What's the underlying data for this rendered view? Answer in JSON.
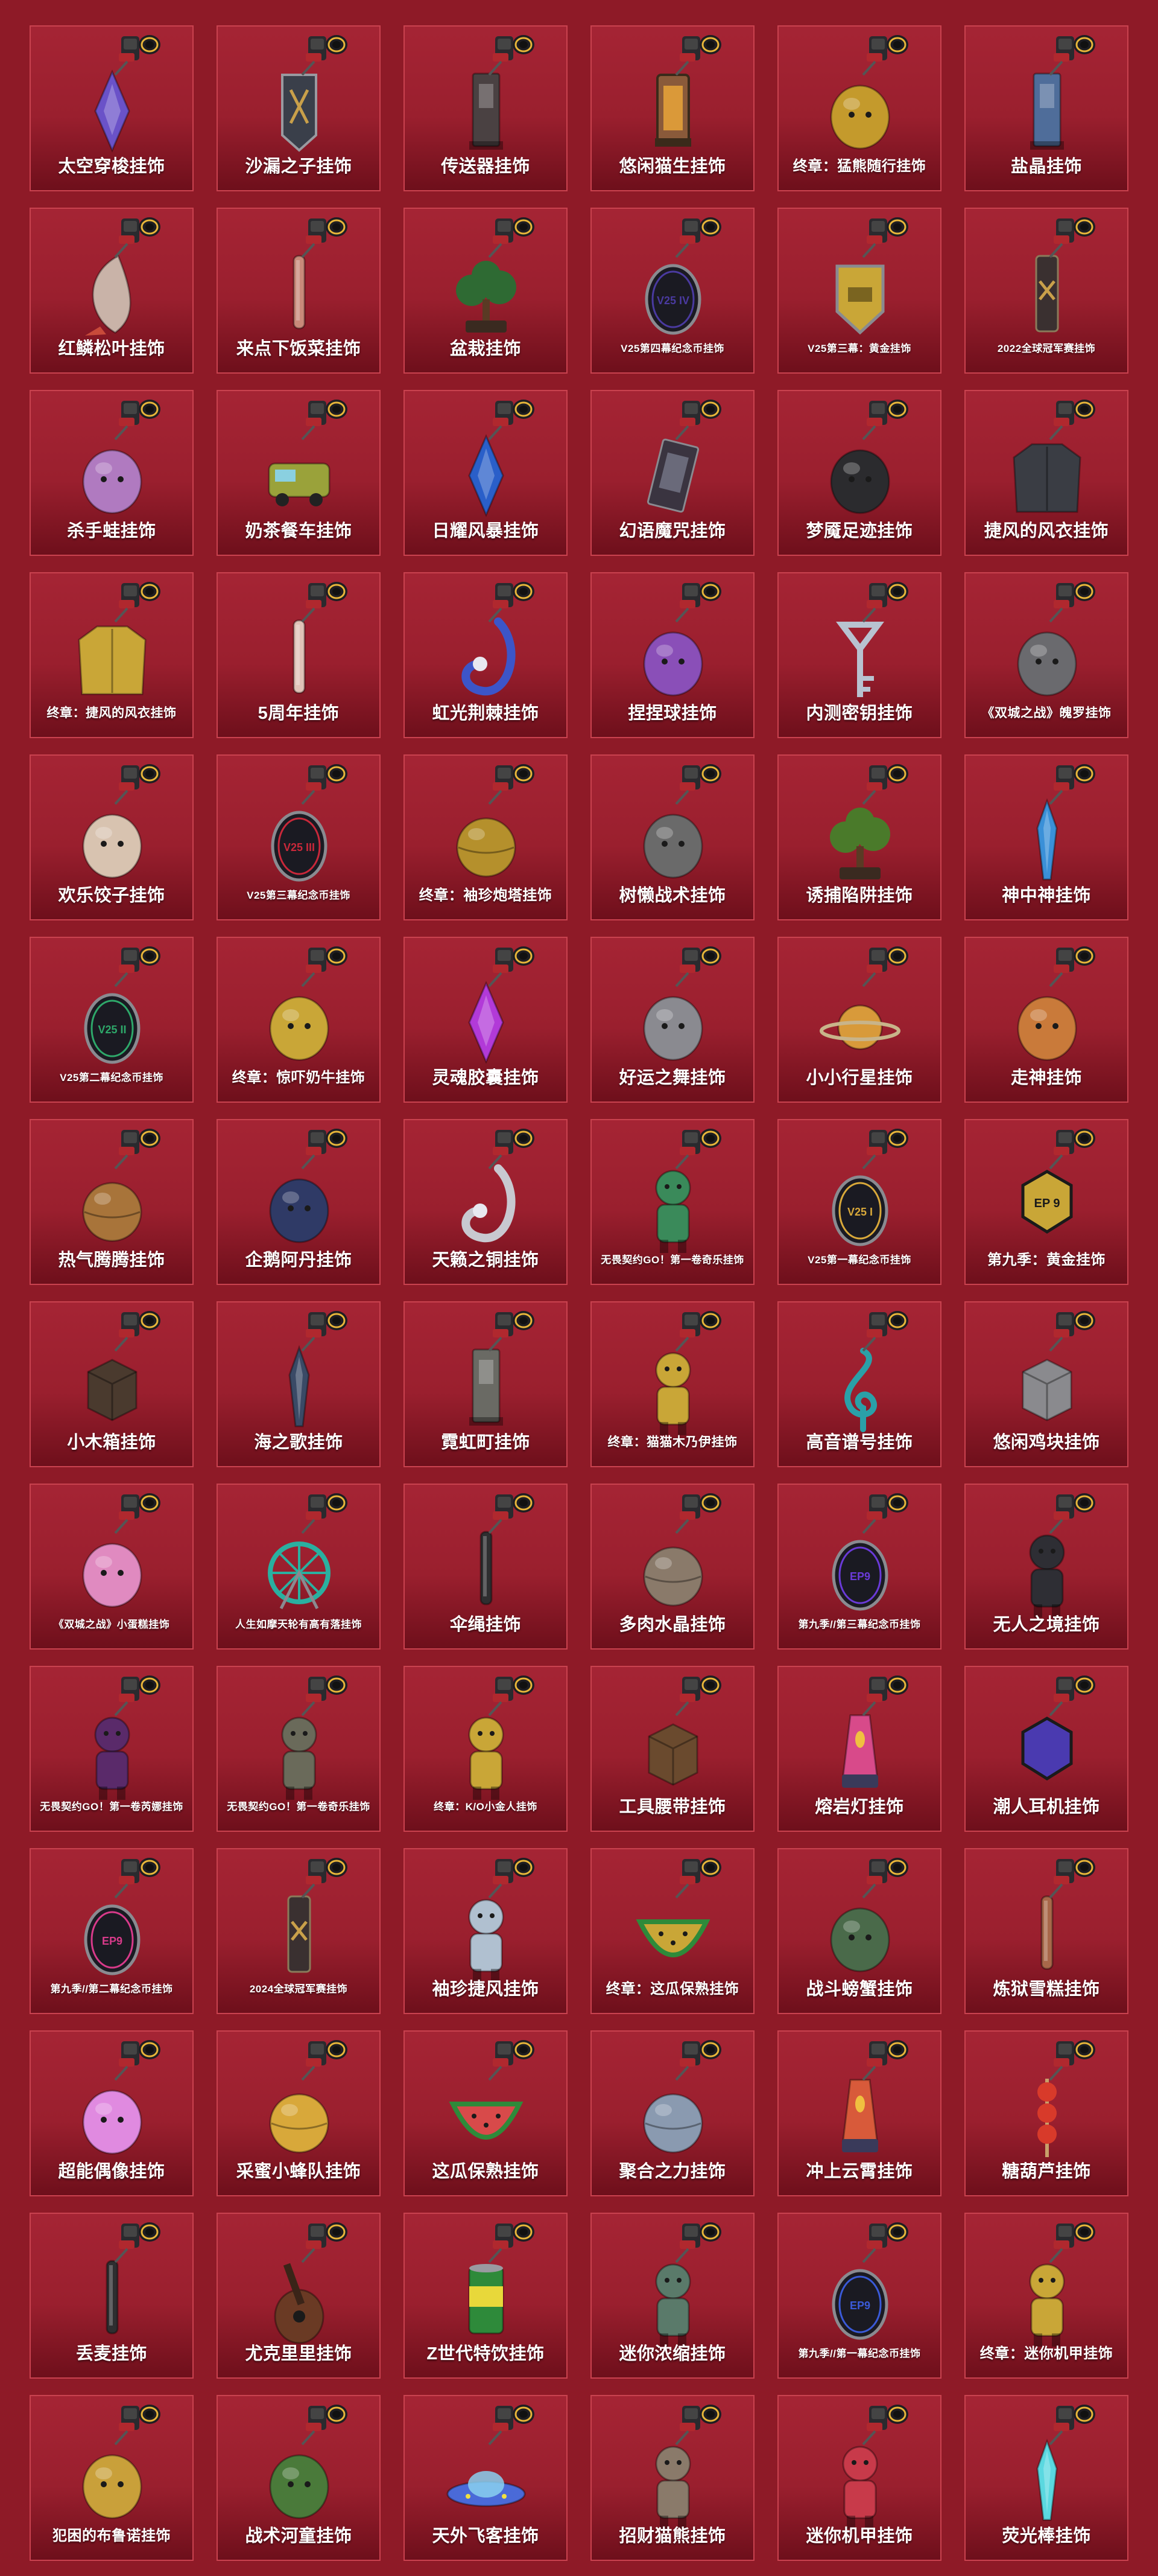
{
  "charms": [
    {
      "name": "太空穿梭挂饰",
      "icon": "purple-shuttle-icon",
      "color": "#6a52c8",
      "shape": "diamond"
    },
    {
      "name": "沙漏之子挂饰",
      "icon": "hourglass-badge-icon",
      "color": "#3a3f4a",
      "shape": "badge"
    },
    {
      "name": "传送器挂饰",
      "icon": "teleporter-icon",
      "color": "#4a4142",
      "shape": "tower"
    },
    {
      "name": "悠闲猫生挂饰",
      "icon": "lantern-icon",
      "color": "#8a5a3a",
      "shape": "lantern"
    },
    {
      "name": "终章：猛熊随行挂饰",
      "icon": "gold-bear-icon",
      "color": "#c49a2c",
      "shape": "blob"
    },
    {
      "name": "盐晶挂饰",
      "icon": "salt-crystal-icon",
      "color": "#4f6d9a",
      "shape": "tower"
    },
    {
      "name": "红鳞松叶挂饰",
      "icon": "fish-icon",
      "color": "#c9b3a8",
      "shape": "fish"
    },
    {
      "name": "来点下饭菜挂饰",
      "icon": "skewer-icon",
      "color": "#c98a7a",
      "shape": "stick"
    },
    {
      "name": "盆栽挂饰",
      "icon": "bonsai-icon",
      "color": "#2e6a33",
      "shape": "tree"
    },
    {
      "name": "V25第四幕纪念币挂饰",
      "icon": "coin-v25-icon",
      "color": "#4a3aa0",
      "shape": "coin",
      "text": "V25 IV"
    },
    {
      "name": "V25第三幕：黄金挂饰",
      "icon": "gold-shield-icon",
      "color": "#c9a637",
      "shape": "shield"
    },
    {
      "name": "2022全球冠军赛挂饰",
      "icon": "champions-tag-icon",
      "color": "#3a3030",
      "shape": "tag"
    },
    {
      "name": "杀手蛙挂饰",
      "icon": "frog-icon",
      "color": "#b07ac0",
      "shape": "blob"
    },
    {
      "name": "奶茶餐车挂饰",
      "icon": "food-truck-icon",
      "color": "#9aa23a",
      "shape": "truck"
    },
    {
      "name": "日耀风暴挂饰",
      "icon": "blue-crystal-icon",
      "color": "#2a5fc9",
      "shape": "diamond"
    },
    {
      "name": "幻语魔咒挂饰",
      "icon": "spellbook-icon",
      "color": "#3a3440",
      "shape": "card"
    },
    {
      "name": "梦魇足迹挂饰",
      "icon": "footprints-icon",
      "color": "#2b2b2e",
      "shape": "blob"
    },
    {
      "name": "捷风的风衣挂饰",
      "icon": "jacket-icon",
      "color": "#3a3d44",
      "shape": "jacket"
    },
    {
      "name": "终章：捷风的风衣挂饰",
      "icon": "gold-jacket-icon",
      "color": "#c9a637",
      "shape": "jacket"
    },
    {
      "name": "5周年挂饰",
      "icon": "cake-slice-icon",
      "color": "#e0c3b8",
      "shape": "stick"
    },
    {
      "name": "虹光荆棘挂饰",
      "icon": "hook-icon",
      "color": "#3c55c8",
      "shape": "hook"
    },
    {
      "name": "捏捏球挂饰",
      "icon": "squishy-icon",
      "color": "#8a4fb8",
      "shape": "blob"
    },
    {
      "name": "内测密钥挂饰",
      "icon": "key-icon",
      "color": "#b8c2d0",
      "shape": "key"
    },
    {
      "name": "《双城之战》魄罗挂饰",
      "icon": "poro-icon",
      "color": "#6a6a6e",
      "shape": "blob"
    },
    {
      "name": "欢乐饺子挂饰",
      "icon": "dumpling-icon",
      "color": "#d8c3b0",
      "shape": "blob"
    },
    {
      "name": "V25第三幕纪念币挂饰",
      "icon": "coin-v25-icon",
      "color": "#c9283a",
      "shape": "coin",
      "text": "V25 III"
    },
    {
      "name": "终章：袖珍炮塔挂饰",
      "icon": "gold-turret-icon",
      "color": "#b5902c",
      "shape": "ball"
    },
    {
      "name": "树懒战术挂饰",
      "icon": "sloth-icon",
      "color": "#6a6a6a",
      "shape": "blob"
    },
    {
      "name": "诱捕陷阱挂饰",
      "icon": "trap-flower-icon",
      "color": "#4a7a2a",
      "shape": "tree"
    },
    {
      "name": "神中神挂饰",
      "icon": "blue-blade-icon",
      "color": "#3a90d8",
      "shape": "blade"
    },
    {
      "name": "V25第二幕纪念币挂饰",
      "icon": "coin-v25-icon",
      "color": "#2ea86a",
      "shape": "coin",
      "text": "V25 II"
    },
    {
      "name": "终章：惊吓奶牛挂饰",
      "icon": "gold-cow-icon",
      "color": "#c9a637",
      "shape": "blob"
    },
    {
      "name": "灵魂胶囊挂饰",
      "icon": "soul-capsule-icon",
      "color": "#b23ad8",
      "shape": "diamond"
    },
    {
      "name": "好运之舞挂饰",
      "icon": "dancer-icon",
      "color": "#8a8a90",
      "shape": "blob"
    },
    {
      "name": "小小行星挂饰",
      "icon": "planet-icon",
      "color": "#d89a3a",
      "shape": "planet"
    },
    {
      "name": "走神挂饰",
      "icon": "critter-icon",
      "color": "#c97a3a",
      "shape": "blob"
    },
    {
      "name": "热气腾腾挂饰",
      "icon": "hotpot-icon",
      "color": "#a8743a",
      "shape": "ball"
    },
    {
      "name": "企鹅阿丹挂饰",
      "icon": "penguin-icon",
      "color": "#2f3a66",
      "shape": "blob"
    },
    {
      "name": "天籁之铜挂饰",
      "icon": "bell-ornament-icon",
      "color": "#c8c8d0",
      "shape": "hook"
    },
    {
      "name": "无畏契约GO！第一卷奇乐挂饰",
      "icon": "figure-icon",
      "color": "#3a8a5a",
      "shape": "figure"
    },
    {
      "name": "V25第一幕纪念币挂饰",
      "icon": "coin-v25-icon",
      "color": "#d8a83a",
      "shape": "coin",
      "text": "V25 I"
    },
    {
      "name": "第九季：黄金挂饰",
      "icon": "ep9-gold-icon",
      "color": "#c9a637",
      "shape": "hex",
      "text": "EP 9"
    },
    {
      "name": "小木箱挂饰",
      "icon": "crate-icon",
      "color": "#4a3a2e",
      "shape": "box"
    },
    {
      "name": "海之歌挂饰",
      "icon": "shell-icon",
      "color": "#3a4a66",
      "shape": "blade"
    },
    {
      "name": "霓虹町挂饰",
      "icon": "building-icon",
      "color": "#6a6a64",
      "shape": "tower"
    },
    {
      "name": "终章：猫猫木乃伊挂饰",
      "icon": "gold-mummy-cat-icon",
      "color": "#c9a637",
      "shape": "figure"
    },
    {
      "name": "高音谱号挂饰",
      "icon": "treble-clef-icon",
      "color": "#2aa0a8",
      "shape": "clef"
    },
    {
      "name": "悠闲鸡块挂饰",
      "icon": "nugget-box-icon",
      "color": "#8a8a8e",
      "shape": "box"
    },
    {
      "name": "《双城之战》小蛋糕挂饰",
      "icon": "cupcake-icon",
      "color": "#e08ac0",
      "shape": "blob"
    },
    {
      "name": "人生如摩天轮有高有落挂饰",
      "icon": "ferris-wheel-icon",
      "color": "#2ab0a0",
      "shape": "wheel"
    },
    {
      "name": "伞绳挂饰",
      "icon": "paracord-icon",
      "color": "#2e2e30",
      "shape": "stick"
    },
    {
      "name": "多肉水晶挂饰",
      "icon": "crystal-pot-icon",
      "color": "#8a7a6a",
      "shape": "ball"
    },
    {
      "name": "第九季//第三幕纪念币挂饰",
      "icon": "coin-ep9-icon",
      "color": "#6a3ad8",
      "shape": "coin",
      "text": "EP9"
    },
    {
      "name": "无人之境挂饰",
      "icon": "masked-figure-icon",
      "color": "#2e2e34",
      "shape": "figure"
    },
    {
      "name": "无畏契约GO！第一卷芮娜挂饰",
      "icon": "figure-icon",
      "color": "#5a2a6a",
      "shape": "figure"
    },
    {
      "name": "无畏契约GO！第一卷奇乐挂饰",
      "icon": "figure-icon",
      "color": "#6a6a5a",
      "shape": "figure"
    },
    {
      "name": "终章：K/O小金人挂饰",
      "icon": "gold-robot-icon",
      "color": "#c9a637",
      "shape": "figure"
    },
    {
      "name": "工具腰带挂饰",
      "icon": "tool-belt-icon",
      "color": "#6a4a2e",
      "shape": "box"
    },
    {
      "name": "熔岩灯挂饰",
      "icon": "lava-lamp-icon",
      "color": "#d84a8a",
      "shape": "lamp"
    },
    {
      "name": "潮人耳机挂饰",
      "icon": "headphones-icon",
      "color": "#4a3ab0",
      "shape": "hex"
    },
    {
      "name": "第九季//第二幕纪念币挂饰",
      "icon": "coin-ep9-icon",
      "color": "#d83a8a",
      "shape": "coin",
      "text": "EP9"
    },
    {
      "name": "2024全球冠军赛挂饰",
      "icon": "crossed-feathers-icon",
      "color": "#3a3030",
      "shape": "tag"
    },
    {
      "name": "袖珍捷风挂饰",
      "icon": "mini-jett-icon",
      "color": "#b0c0d0",
      "shape": "figure"
    },
    {
      "name": "终章：这瓜保熟挂饰",
      "icon": "gold-melon-icon",
      "color": "#c9a637",
      "shape": "melon"
    },
    {
      "name": "战斗螃蟹挂饰",
      "icon": "crab-icon",
      "color": "#4a6a4a",
      "shape": "blob"
    },
    {
      "name": "炼狱雪糕挂饰",
      "icon": "popsicle-icon",
      "color": "#a8684a",
      "shape": "stick"
    },
    {
      "name": "超能偶像挂饰",
      "icon": "idol-icon",
      "color": "#e08ae0",
      "shape": "blob"
    },
    {
      "name": "采蜜小蜂队挂饰",
      "icon": "beehive-icon",
      "color": "#d8a83a",
      "shape": "ball"
    },
    {
      "name": "这瓜保熟挂饰",
      "icon": "watermelon-icon",
      "color": "#d84a4a",
      "shape": "melon"
    },
    {
      "name": "聚合之力挂饰",
      "icon": "orb-icon",
      "color": "#8a9ab0",
      "shape": "ball"
    },
    {
      "name": "冲上云霄挂饰",
      "icon": "hot-air-balloon-icon",
      "color": "#d85a3a",
      "shape": "lamp"
    },
    {
      "name": "糖葫芦挂饰",
      "icon": "candied-haws-icon",
      "color": "#d83a2a",
      "shape": "haws"
    },
    {
      "name": "丢麦挂饰",
      "icon": "microphone-icon",
      "color": "#2e2e30",
      "shape": "stick"
    },
    {
      "name": "尤克里里挂饰",
      "icon": "ukulele-icon",
      "color": "#6a3a24",
      "shape": "guitar"
    },
    {
      "name": "Z世代特饮挂饰",
      "icon": "soda-can-icon",
      "color": "#2e8a3a",
      "shape": "can"
    },
    {
      "name": "迷你浓缩挂饰",
      "icon": "robot-icon",
      "color": "#5a7a6a",
      "shape": "figure"
    },
    {
      "name": "第九季//第一幕纪念币挂饰",
      "icon": "coin-ep9-icon",
      "color": "#3a5ad8",
      "shape": "coin",
      "text": "EP9"
    },
    {
      "name": "终章：迷你机甲挂饰",
      "icon": "gold-mech-icon",
      "color": "#c9a637",
      "shape": "figure"
    },
    {
      "name": "犯困的布鲁诺挂饰",
      "icon": "sleepy-bear-icon",
      "color": "#c9a03a",
      "shape": "blob"
    },
    {
      "name": "战术河童挂饰",
      "icon": "kappa-icon",
      "color": "#4a7a3a",
      "shape": "blob"
    },
    {
      "name": "天外飞客挂饰",
      "icon": "ufo-icon",
      "color": "#4a6ad8",
      "shape": "ufo"
    },
    {
      "name": "招财猫熊挂饰",
      "icon": "raccoon-icon",
      "color": "#8a7a6a",
      "shape": "figure"
    },
    {
      "name": "迷你机甲挂饰",
      "icon": "mech-icon",
      "color": "#c83a4a",
      "shape": "figure"
    },
    {
      "name": "荧光棒挂饰",
      "icon": "glowstick-icon",
      "color": "#5ad8e0",
      "shape": "blade"
    }
  ]
}
